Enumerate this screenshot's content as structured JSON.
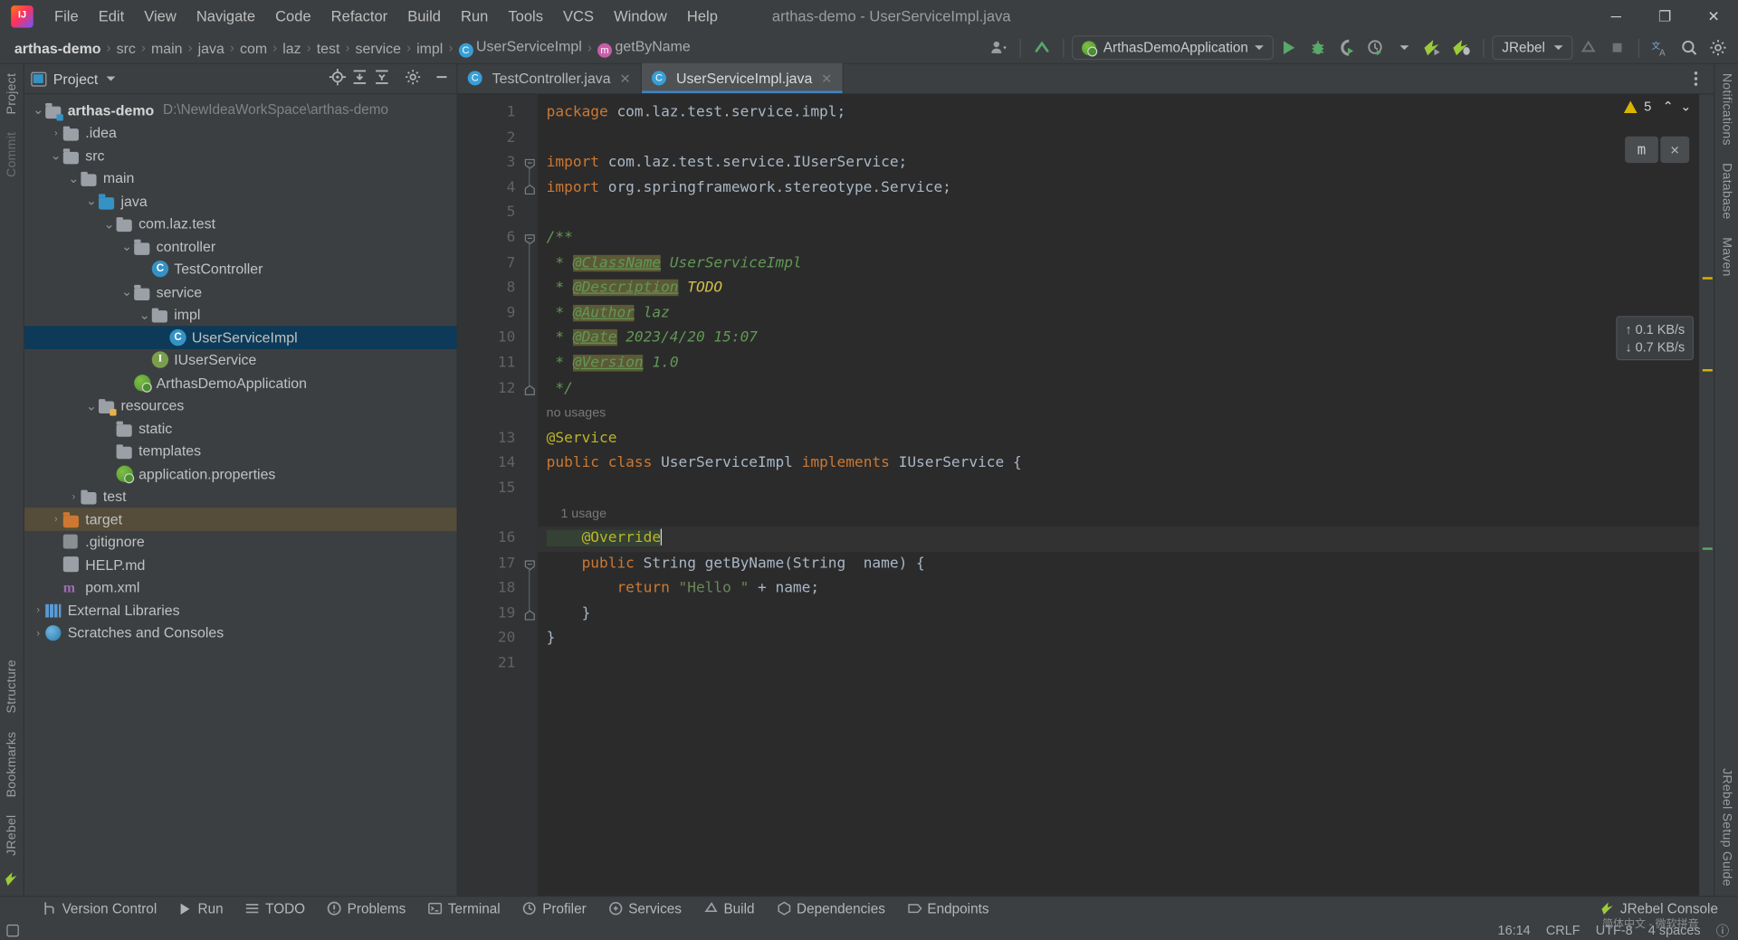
{
  "window": {
    "title": "arthas-demo - UserServiceImpl.java",
    "minimize": "─",
    "maximize": "❐",
    "close": "✕"
  },
  "menubar": {
    "logo": "ij-logo",
    "items": [
      "File",
      "Edit",
      "View",
      "Navigate",
      "Code",
      "Refactor",
      "Build",
      "Run",
      "Tools",
      "VCS",
      "Window",
      "Help"
    ]
  },
  "breadcrumb": {
    "items": [
      {
        "label": "arthas-demo",
        "icon": "",
        "bold": true
      },
      {
        "label": "src",
        "icon": ""
      },
      {
        "label": "main",
        "icon": ""
      },
      {
        "label": "java",
        "icon": ""
      },
      {
        "label": "com",
        "icon": ""
      },
      {
        "label": "laz",
        "icon": ""
      },
      {
        "label": "test",
        "icon": ""
      },
      {
        "label": "service",
        "icon": ""
      },
      {
        "label": "impl",
        "icon": ""
      },
      {
        "label": "UserServiceImpl",
        "icon": "C"
      },
      {
        "label": "getByName",
        "icon": "m"
      }
    ],
    "separator": "›"
  },
  "toolbar": {
    "run_config": "ArthasDemoApplication",
    "jrebel_label": "JRebel",
    "icons": [
      "user-settings-icon",
      "updates-icon",
      "run-icon",
      "debug-icon",
      "run-coverage-icon",
      "profiler-icon",
      "jrebel-run-icon",
      "jrebel-debug-icon",
      "build-icon",
      "stop-icon",
      "translate-icon",
      "search-icon",
      "settings-icon",
      "notifications-icon"
    ]
  },
  "project_panel": {
    "title": "Project",
    "icons": [
      "locate-icon",
      "expand-all-icon",
      "collapse-all-icon",
      "settings-icon",
      "hide-icon"
    ],
    "tree": [
      {
        "indent": 0,
        "arrow": "down",
        "icon": "module-folder",
        "label": "arthas-demo",
        "bold": true,
        "path": "D:\\NewIdeaWorkSpace\\arthas-demo"
      },
      {
        "indent": 1,
        "arrow": "right",
        "icon": "folder",
        "label": ".idea"
      },
      {
        "indent": 1,
        "arrow": "down",
        "icon": "folder",
        "label": "src"
      },
      {
        "indent": 2,
        "arrow": "down",
        "icon": "folder",
        "label": "main"
      },
      {
        "indent": 3,
        "arrow": "down",
        "icon": "source-folder",
        "label": "java"
      },
      {
        "indent": 4,
        "arrow": "down",
        "icon": "package",
        "label": "com.laz.test"
      },
      {
        "indent": 5,
        "arrow": "down",
        "icon": "package",
        "label": "controller"
      },
      {
        "indent": 6,
        "arrow": "none",
        "icon": "class",
        "label": "TestController"
      },
      {
        "indent": 5,
        "arrow": "down",
        "icon": "package",
        "label": "service"
      },
      {
        "indent": 6,
        "arrow": "down",
        "icon": "package",
        "label": "impl"
      },
      {
        "indent": 7,
        "arrow": "none",
        "icon": "class",
        "label": "UserServiceImpl",
        "state": "selected"
      },
      {
        "indent": 6,
        "arrow": "none",
        "icon": "interface",
        "label": "IUserService"
      },
      {
        "indent": 5,
        "arrow": "none",
        "icon": "spring-app",
        "label": "ArthasDemoApplication"
      },
      {
        "indent": 3,
        "arrow": "down",
        "icon": "resource-folder",
        "label": "resources"
      },
      {
        "indent": 4,
        "arrow": "none",
        "icon": "folder",
        "label": "static"
      },
      {
        "indent": 4,
        "arrow": "none",
        "icon": "folder",
        "label": "templates"
      },
      {
        "indent": 4,
        "arrow": "none",
        "icon": "spring-config",
        "label": "application.properties"
      },
      {
        "indent": 2,
        "arrow": "right",
        "icon": "folder",
        "label": "test"
      },
      {
        "indent": 1,
        "arrow": "right",
        "icon": "excluded-folder",
        "label": "target",
        "state": "excluded"
      },
      {
        "indent": 1,
        "arrow": "none",
        "icon": "git-file",
        "label": ".gitignore"
      },
      {
        "indent": 1,
        "arrow": "none",
        "icon": "md-file",
        "label": "HELP.md"
      },
      {
        "indent": 1,
        "arrow": "none",
        "icon": "maven-file",
        "label": "pom.xml"
      },
      {
        "indent": 0,
        "arrow": "right",
        "icon": "libraries",
        "label": "External Libraries"
      },
      {
        "indent": 0,
        "arrow": "right",
        "icon": "scratches",
        "label": "Scratches and Consoles"
      }
    ]
  },
  "editor": {
    "tabs": [
      {
        "label": "TestController.java",
        "icon": "C",
        "active": false,
        "close": "✕"
      },
      {
        "label": "UserServiceImpl.java",
        "icon": "C",
        "active": true,
        "close": "✕"
      }
    ],
    "inspection": {
      "count": "5",
      "warn_icon": "warning-triangle-icon",
      "up": "⌃",
      "down": "⌄"
    },
    "float_buttons": {
      "chip": "m",
      "close": "✕"
    },
    "network": {
      "upload": "↑ 0.1 KB/s",
      "download": "↓ 0.7 KB/s"
    },
    "lines": [
      {
        "num": "1",
        "fold": "none",
        "tokens": [
          {
            "t": "kw",
            "v": "package"
          },
          {
            "t": "id",
            "v": " com.laz.test.service.impl;"
          }
        ]
      },
      {
        "num": "2",
        "fold": "none",
        "tokens": []
      },
      {
        "num": "3",
        "fold": "start",
        "tokens": [
          {
            "t": "kw",
            "v": "import"
          },
          {
            "t": "id",
            "v": " com.laz.test.service.IUserService;"
          }
        ]
      },
      {
        "num": "4",
        "fold": "end",
        "tokens": [
          {
            "t": "kw",
            "v": "import"
          },
          {
            "t": "id",
            "v": " org.springframework.stereotype."
          },
          {
            "t": "id",
            "v": "Service;"
          }
        ]
      },
      {
        "num": "5",
        "fold": "none",
        "tokens": []
      },
      {
        "num": "6",
        "fold": "start",
        "tokens": [
          {
            "t": "cmt",
            "v": "/**"
          }
        ]
      },
      {
        "num": "7",
        "fold": "none",
        "tokens": [
          {
            "t": "cmt",
            "v": " * "
          },
          {
            "t": "jdoc-tag",
            "v": "@ClassName"
          },
          {
            "t": "jdoc-val",
            "v": " UserServiceImpl"
          }
        ]
      },
      {
        "num": "8",
        "fold": "none",
        "tokens": [
          {
            "t": "cmt",
            "v": " * "
          },
          {
            "t": "jdoc-tag",
            "v": "@Description"
          },
          {
            "t": "todo",
            "v": " TODO"
          }
        ]
      },
      {
        "num": "9",
        "fold": "none",
        "tokens": [
          {
            "t": "cmt",
            "v": " * "
          },
          {
            "t": "jdoc-tag",
            "v": "@Author"
          },
          {
            "t": "jdoc-val",
            "v": " laz"
          }
        ]
      },
      {
        "num": "10",
        "fold": "none",
        "tokens": [
          {
            "t": "cmt",
            "v": " * "
          },
          {
            "t": "jdoc-tag",
            "v": "@Date"
          },
          {
            "t": "jdoc-val",
            "v": " 2023/4/20 15:07"
          }
        ]
      },
      {
        "num": "11",
        "fold": "none",
        "tokens": [
          {
            "t": "cmt",
            "v": " * "
          },
          {
            "t": "jdoc-tag",
            "v": "@Version"
          },
          {
            "t": "jdoc-val",
            "v": " 1.0"
          }
        ]
      },
      {
        "num": "12",
        "fold": "end",
        "tokens": [
          {
            "t": "cmt",
            "v": " */"
          }
        ]
      },
      {
        "num": "",
        "fold": "none",
        "hint": "no usages",
        "tokens": []
      },
      {
        "num": "13",
        "fold": "none",
        "tokens": [
          {
            "t": "anno",
            "v": "@Service"
          }
        ]
      },
      {
        "num": "14",
        "fold": "none",
        "gmark": "spring-bean-icon",
        "tokens": [
          {
            "t": "kw",
            "v": "public class "
          },
          {
            "t": "id",
            "v": "UserServiceImpl "
          },
          {
            "t": "kw",
            "v": "implements "
          },
          {
            "t": "id",
            "v": "IUserService {"
          }
        ]
      },
      {
        "num": "15",
        "fold": "none",
        "tokens": []
      },
      {
        "num": "",
        "fold": "none",
        "hint": "    1 usage",
        "tokens": []
      },
      {
        "num": "16",
        "fold": "none",
        "current": true,
        "tokens": [
          {
            "t": "anno anno-hl",
            "v": "    @Override"
          },
          {
            "t": "caret",
            "v": ""
          }
        ]
      },
      {
        "num": "17",
        "fold": "start",
        "gmark": "implementing-method-icon",
        "tokens": [
          {
            "t": "kw",
            "v": "    public "
          },
          {
            "t": "id",
            "v": "String "
          },
          {
            "t": "id",
            "v": "getByName"
          },
          {
            "t": "id",
            "v": "(String  name) {"
          }
        ]
      },
      {
        "num": "18",
        "fold": "none",
        "tokens": [
          {
            "t": "kw",
            "v": "        return "
          },
          {
            "t": "str",
            "v": "\"Hello \""
          },
          {
            "t": "id",
            "v": " + name;"
          }
        ]
      },
      {
        "num": "19",
        "fold": "end",
        "tokens": [
          {
            "t": "id",
            "v": "    }"
          }
        ]
      },
      {
        "num": "20",
        "fold": "none",
        "tokens": [
          {
            "t": "id",
            "v": "}"
          }
        ]
      },
      {
        "num": "21",
        "fold": "none",
        "tokens": []
      }
    ]
  },
  "left_strip": {
    "items": [
      "Project",
      "Commit"
    ]
  },
  "left_strip_bottom": {
    "items": [
      "Structure",
      "Bookmarks",
      "JRebel"
    ]
  },
  "right_strip": {
    "items": [
      "Notifications",
      "Database",
      "Maven"
    ]
  },
  "right_strip_bottom": {
    "items": [
      "JRebel Setup Guide"
    ]
  },
  "bottom_bar": {
    "items": [
      {
        "label": "Version Control",
        "icon": "branch-icon"
      },
      {
        "label": "Run",
        "icon": "run-icon"
      },
      {
        "label": "TODO",
        "icon": "todo-icon"
      },
      {
        "label": "Problems",
        "icon": "problems-icon"
      },
      {
        "label": "Terminal",
        "icon": "terminal-icon"
      },
      {
        "label": "Profiler",
        "icon": "profiler-icon"
      },
      {
        "label": "Services",
        "icon": "services-icon"
      },
      {
        "label": "Build",
        "icon": "build-icon"
      },
      {
        "label": "Dependencies",
        "icon": "dependencies-icon"
      },
      {
        "label": "Endpoints",
        "icon": "endpoints-icon"
      }
    ],
    "right": [
      {
        "label": "JRebel Console",
        "icon": "jrebel-icon"
      }
    ]
  },
  "statusbar": {
    "left_icon": "layout-icon",
    "right": [
      "16:14",
      "CRLF",
      "UTF-8",
      "4 spaces",
      "ⓘ"
    ],
    "ime": "简体中文 - 微软拼音"
  },
  "colors": {
    "accent": "#3d87c7",
    "selection": "#0d3a58",
    "excluded": "#554d3a",
    "keyword": "#cc7832",
    "comment": "#629755",
    "string": "#6a8759",
    "annotation": "#bbb529",
    "identifier": "#a9b7c6",
    "editor_bg": "#2b2b2b",
    "panel_bg": "#3c3f41",
    "green": "#59a869"
  }
}
